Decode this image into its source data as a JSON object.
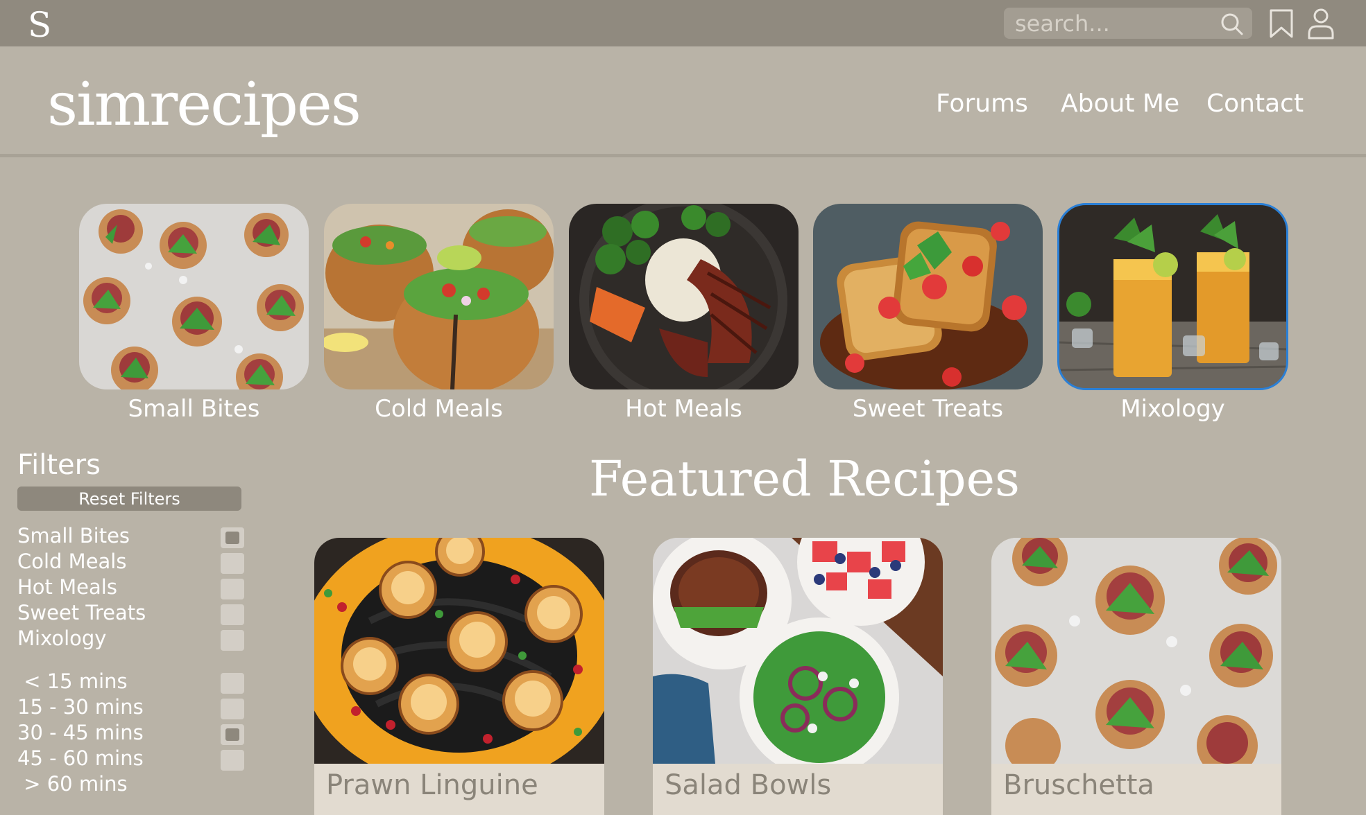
{
  "topbar": {
    "logo_letter": "S",
    "search_placeholder": "search...",
    "icons": [
      "search-icon",
      "bookmark-icon",
      "user-icon"
    ]
  },
  "header": {
    "brand": "simrecipes",
    "nav": [
      "Forums",
      "About Me",
      "Contact"
    ]
  },
  "categories": [
    {
      "label": "Small Bites",
      "selected": false
    },
    {
      "label": "Cold Meals",
      "selected": false
    },
    {
      "label": "Hot Meals",
      "selected": false
    },
    {
      "label": "Sweet Treats",
      "selected": false
    },
    {
      "label": "Mixology",
      "selected": true
    }
  ],
  "filters": {
    "title": "Filters",
    "reset_label": "Reset Filters",
    "category_options": [
      {
        "label": "Small Bites",
        "checked": true
      },
      {
        "label": "Cold Meals",
        "checked": false
      },
      {
        "label": "Hot Meals",
        "checked": false
      },
      {
        "label": "Sweet Treats",
        "checked": false
      },
      {
        "label": "Mixology",
        "checked": false
      }
    ],
    "time_options": [
      {
        "label": " < 15 mins",
        "checked": false
      },
      {
        "label": "15 - 30 mins",
        "checked": false
      },
      {
        "label": "30 - 45 mins",
        "checked": true
      },
      {
        "label": "45 - 60 mins",
        "checked": false
      },
      {
        "label": " > 60 mins",
        "checked": false
      }
    ]
  },
  "featured": {
    "title": "Featured Recipes",
    "recipes": [
      {
        "title": "Prawn Linguine"
      },
      {
        "title": "Salad Bowls"
      },
      {
        "title": "Bruschetta"
      }
    ]
  },
  "colors": {
    "topbar": "#908a7f",
    "background": "#b9b3a7",
    "card_footer": "#e2dbd0",
    "selected_outline": "#2a7fd6"
  }
}
